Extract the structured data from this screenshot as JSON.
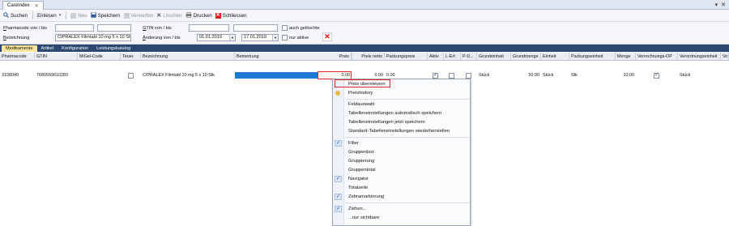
{
  "document_tab": {
    "title": "CareIndex",
    "close": "✕"
  },
  "window_controls": [
    "▾",
    "✕"
  ],
  "toolbar": {
    "search": "Suchen",
    "import": "Einlesen",
    "new": "Neu",
    "save": "Speichern",
    "discard": "Verwerfen",
    "delete": "Löschen",
    "print": "Drucken",
    "close": "Schliessen"
  },
  "filter": {
    "pharmacode_label_u": "P",
    "pharmacode_label_rest": "harmacode von / bis",
    "bezeichnung_label_u": "B",
    "bezeichnung_label_rest": "ezeichnung",
    "bezeichnung_value": "CIPRALEX Filmtabl 10 mg 5 x 10 Stk",
    "gtin_label_u": "G",
    "gtin_label_rest": "TIN von / bis",
    "aenderung_label_u": "Ä",
    "aenderung_label_rest": "nderung von / bis",
    "date_from": "01.01.2019",
    "date_to": "17.01.2019",
    "deleted_label": "auch gelöschte",
    "active_label": "nur aktive"
  },
  "data_tabs": [
    "Medikamente",
    "Artikel",
    "Konfiguration",
    "Leistungskatalog"
  ],
  "grid": {
    "headers": [
      "Pharmacode",
      "GTIN",
      "MiGel-Code",
      "Teuer",
      "Bezeichnung",
      "Bemerkung",
      "Preis",
      "Preis netto",
      "Packungspreis",
      "Aktiv",
      "L-Erf.",
      "P-D...",
      "Grundeinheit",
      "Grundmenge",
      "Einheit",
      "Packungseinheit",
      "Menge",
      "Verrechnungs-OP",
      "Verordnungseinheit",
      "Vo"
    ],
    "row": {
      "pharmacode": "3108040",
      "gtin": "7680559610283",
      "bezeichnung": "CIPRALEX Filmtabl 10 mg 5 x 10 Stk",
      "preis": "0.00",
      "preis_netto": "0.00",
      "packungspreis": "0.00",
      "grundeinheit": "Stück",
      "grundmenge": "50.00",
      "einheit": "Stück",
      "packungseinheit": "Stk",
      "menge": "10.00",
      "verordnungseinheit": "Stück"
    }
  },
  "context_menu": [
    "Preis übersteuern",
    "Preishistory",
    "Feldauswahl",
    "Tabelleneinstellungen automatisch speichern",
    "Tabelleneinstellungen jetzt speichern",
    "Standard-Tabelleneinstellungen wiederherstellen",
    "Filter",
    "Gruppenbox",
    "Gruppierung",
    "Gruppentotal",
    "Navigator",
    "Totalzeile",
    "Zebramarkierung",
    "Ziehen...",
    "...nur sichtbare"
  ],
  "colors": {
    "accent_blue": "#1c7bd5",
    "highlight_red": "#e02424",
    "tab_bar": "#2c4870",
    "active_tab": "#fbe59b"
  }
}
